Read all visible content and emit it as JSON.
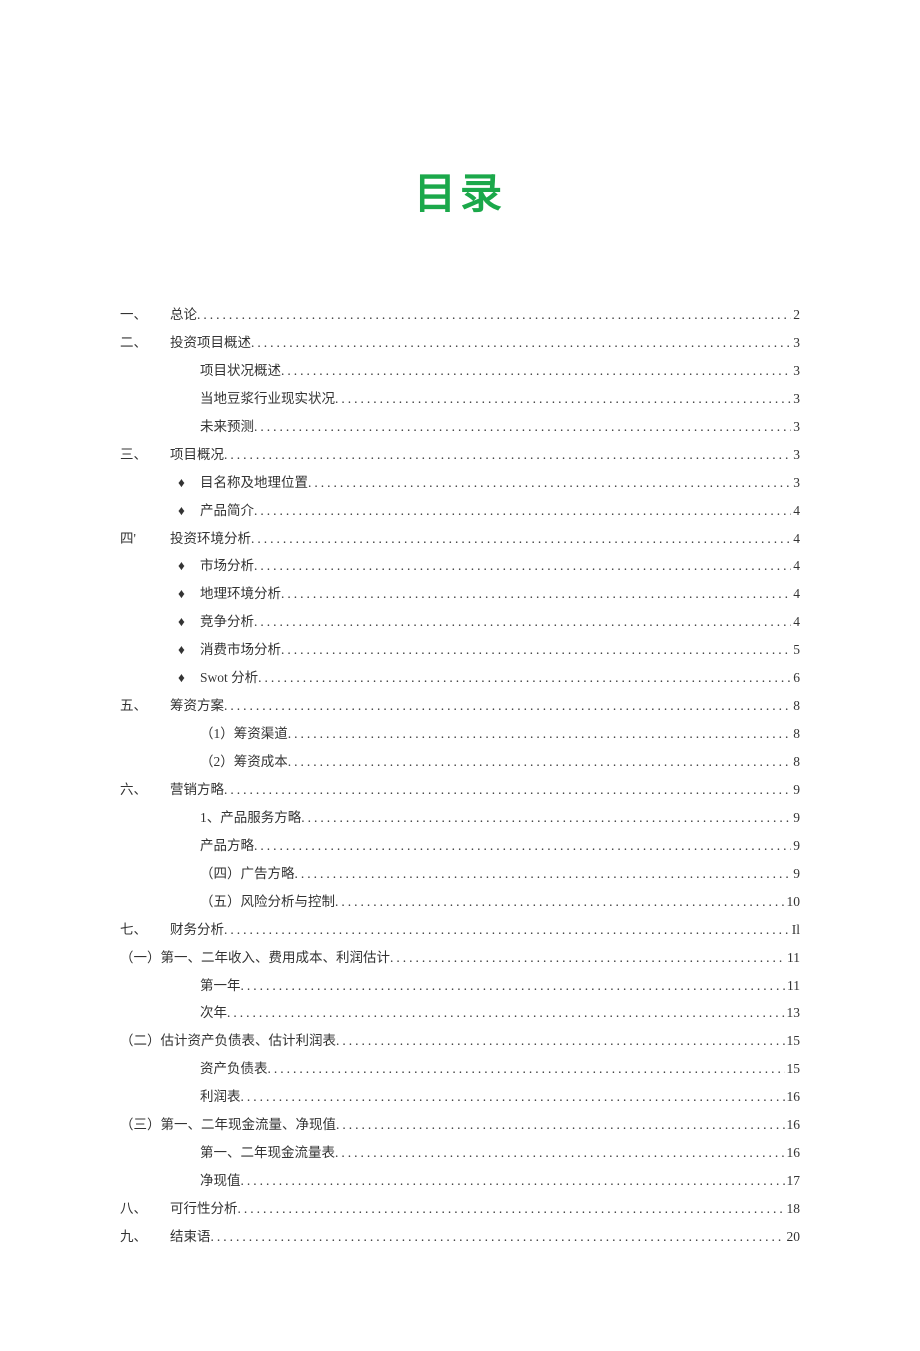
{
  "title": "目录",
  "entries": [
    {
      "num": "一、",
      "bullet": "",
      "indent": 0,
      "text": "总论",
      "page": "2"
    },
    {
      "num": "二、",
      "bullet": "",
      "indent": 0,
      "text": "投资项目概述",
      "page": "3"
    },
    {
      "num": "",
      "bullet": "",
      "indent": 1,
      "text": "项目状况概述",
      "page": "3"
    },
    {
      "num": "",
      "bullet": "",
      "indent": 1,
      "text": "当地豆浆行业现实状况",
      "page": "3"
    },
    {
      "num": "",
      "bullet": "",
      "indent": 1,
      "text": "未来预测",
      "page": "3"
    },
    {
      "num": "三、",
      "bullet": "",
      "indent": 0,
      "text": "项目概况",
      "page": "3"
    },
    {
      "num": "",
      "bullet": "♦",
      "indent": 1,
      "text": "目名称及地理位置",
      "page": "3"
    },
    {
      "num": "",
      "bullet": "♦",
      "indent": 1,
      "text": "产品简介",
      "page": "4"
    },
    {
      "num": "四'",
      "bullet": "",
      "indent": 0,
      "text": "投资环境分析",
      "page": "4"
    },
    {
      "num": "",
      "bullet": "♦",
      "indent": 1,
      "text": "市场分析",
      "page": "4"
    },
    {
      "num": "",
      "bullet": "♦",
      "indent": 1,
      "text": "地理环境分析",
      "page": "4"
    },
    {
      "num": "",
      "bullet": "♦",
      "indent": 1,
      "text": "竞争分析",
      "page": "4"
    },
    {
      "num": "",
      "bullet": "♦",
      "indent": 1,
      "text": "消费市场分析",
      "page": "5"
    },
    {
      "num": "",
      "bullet": "♦",
      "indent": 1,
      "text": "Swot 分析",
      "page": "6"
    },
    {
      "num": "五、",
      "bullet": "",
      "indent": 0,
      "text": "筹资方案",
      "page": "8"
    },
    {
      "num": "",
      "bullet": "",
      "indent": 1,
      "text": "（1）筹资渠道",
      "page": "8"
    },
    {
      "num": "",
      "bullet": "",
      "indent": 1,
      "text": "（2）筹资成本",
      "page": "8"
    },
    {
      "num": "六、",
      "bullet": "",
      "indent": 0,
      "text": "营销方略",
      "page": "9"
    },
    {
      "num": "",
      "bullet": "",
      "indent": 1,
      "text": "1、产品服务方略",
      "page": "9"
    },
    {
      "num": "",
      "bullet": "",
      "indent": 1,
      "text": "产品方略",
      "page": "9"
    },
    {
      "num": "",
      "bullet": "",
      "indent": 1,
      "text": "（四）广告方略",
      "page": "9"
    },
    {
      "num": "",
      "bullet": "",
      "indent": 1,
      "text": "（五）风险分析与控制",
      "page": "10"
    },
    {
      "num": "七、",
      "bullet": "",
      "indent": 0,
      "text": "财务分析",
      "page": "Il"
    },
    {
      "num": "",
      "bullet": "",
      "indent": -1,
      "text": "（一）第一、二年收入、费用成本、利润估计",
      "page": "11"
    },
    {
      "num": "",
      "bullet": "",
      "indent": 1,
      "text": "第一年",
      "page": "11"
    },
    {
      "num": "",
      "bullet": "",
      "indent": 1,
      "text": "次年",
      "page": "13"
    },
    {
      "num": "",
      "bullet": "",
      "indent": -1,
      "text": "（二）估计资产负债表、估计利润表",
      "page": "15"
    },
    {
      "num": "",
      "bullet": "",
      "indent": 1,
      "text": "资产负债表",
      "page": "15"
    },
    {
      "num": "",
      "bullet": "",
      "indent": 1,
      "text": "利润表",
      "page": "16"
    },
    {
      "num": "",
      "bullet": "",
      "indent": -1,
      "text": "（三）第一、二年现金流量、净现值",
      "page": "16"
    },
    {
      "num": "",
      "bullet": "",
      "indent": 1,
      "text": "第一、二年现金流量表",
      "page": "16"
    },
    {
      "num": "",
      "bullet": "",
      "indent": 1,
      "text": "净现值",
      "page": "17"
    },
    {
      "num": "八、",
      "bullet": "",
      "indent": 0,
      "text": "可行性分析",
      "page": "18"
    },
    {
      "num": "九、",
      "bullet": "",
      "indent": 0,
      "text": "结束语",
      "page": "20"
    }
  ]
}
